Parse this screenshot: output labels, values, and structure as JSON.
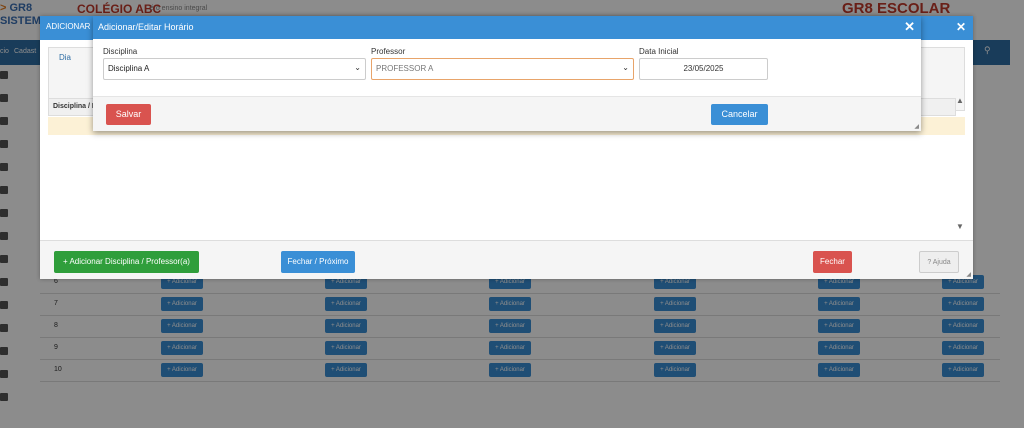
{
  "header": {
    "logo_line1": "GR8",
    "logo_line2": "SISTEM",
    "school_name": "COLÉGIO ABC",
    "school_sub": "é o ensino integral",
    "brand_right": "GR8 ESCOLAR"
  },
  "nav": {
    "items": [
      "cio",
      "Cadast"
    ]
  },
  "bg_table": {
    "rows": [
      "6",
      "7",
      "8",
      "9",
      "10"
    ],
    "add_label": "+ Adicionar"
  },
  "mid_modal": {
    "title": "ADICIONAR",
    "dia_label": "Dia",
    "table_header": "Disciplina / P",
    "buttons": {
      "add": "+  Adicionar Disciplina / Professor(a)",
      "close_next": "Fechar / Próximo",
      "close": "Fechar",
      "help": "? Ajuda"
    },
    "colors": {
      "green": "#2f9e3b",
      "blue": "#3a8fd6",
      "red": "#d9534f"
    }
  },
  "top_modal": {
    "title": "Adicionar/Editar Horário",
    "fields": {
      "disciplina_label": "Disciplina",
      "disciplina_value": "Disciplina A",
      "professor_label": "Professor",
      "professor_value": "PROFESSOR A",
      "data_label": "Data Inicial",
      "data_value": "23/05/2025"
    },
    "buttons": {
      "save": "Salvar",
      "cancel": "Cancelar"
    }
  }
}
